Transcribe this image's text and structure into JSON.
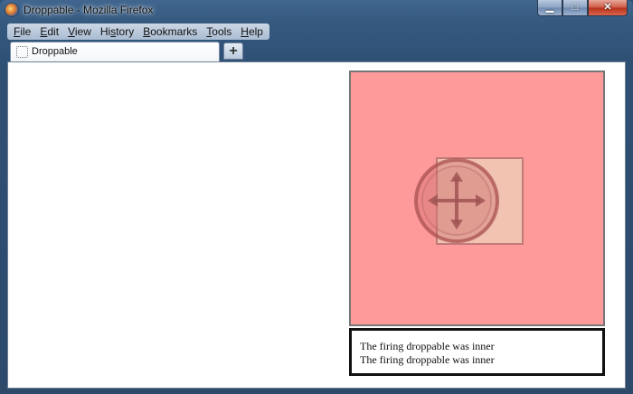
{
  "window": {
    "title": "Droppable - Mozilla Firefox",
    "buttons": {
      "minimize": "▁",
      "maximize": "□",
      "close": "✕"
    }
  },
  "menu": [
    {
      "label": "File",
      "accel": "F",
      "rest": "ile"
    },
    {
      "label": "Edit",
      "accel": "E",
      "rest": "dit"
    },
    {
      "label": "View",
      "accel": "V",
      "rest": "iew"
    },
    {
      "label": "History",
      "pre": "Hi",
      "accel": "s",
      "rest": "tory"
    },
    {
      "label": "Bookmarks",
      "accel": "B",
      "rest": "ookmarks"
    },
    {
      "label": "Tools",
      "accel": "T",
      "rest": "ools"
    },
    {
      "label": "Help",
      "accel": "H",
      "rest": "elp"
    }
  ],
  "tabs": [
    {
      "label": "Droppable"
    }
  ],
  "new_tab_label": "+",
  "page": {
    "outer_color": "#ff9a9a",
    "inner_color": "#f2c3b1",
    "drag_icon": "move-cursor-icon",
    "log_lines": [
      "The firing droppable was inner",
      "The firing droppable was inner"
    ]
  }
}
